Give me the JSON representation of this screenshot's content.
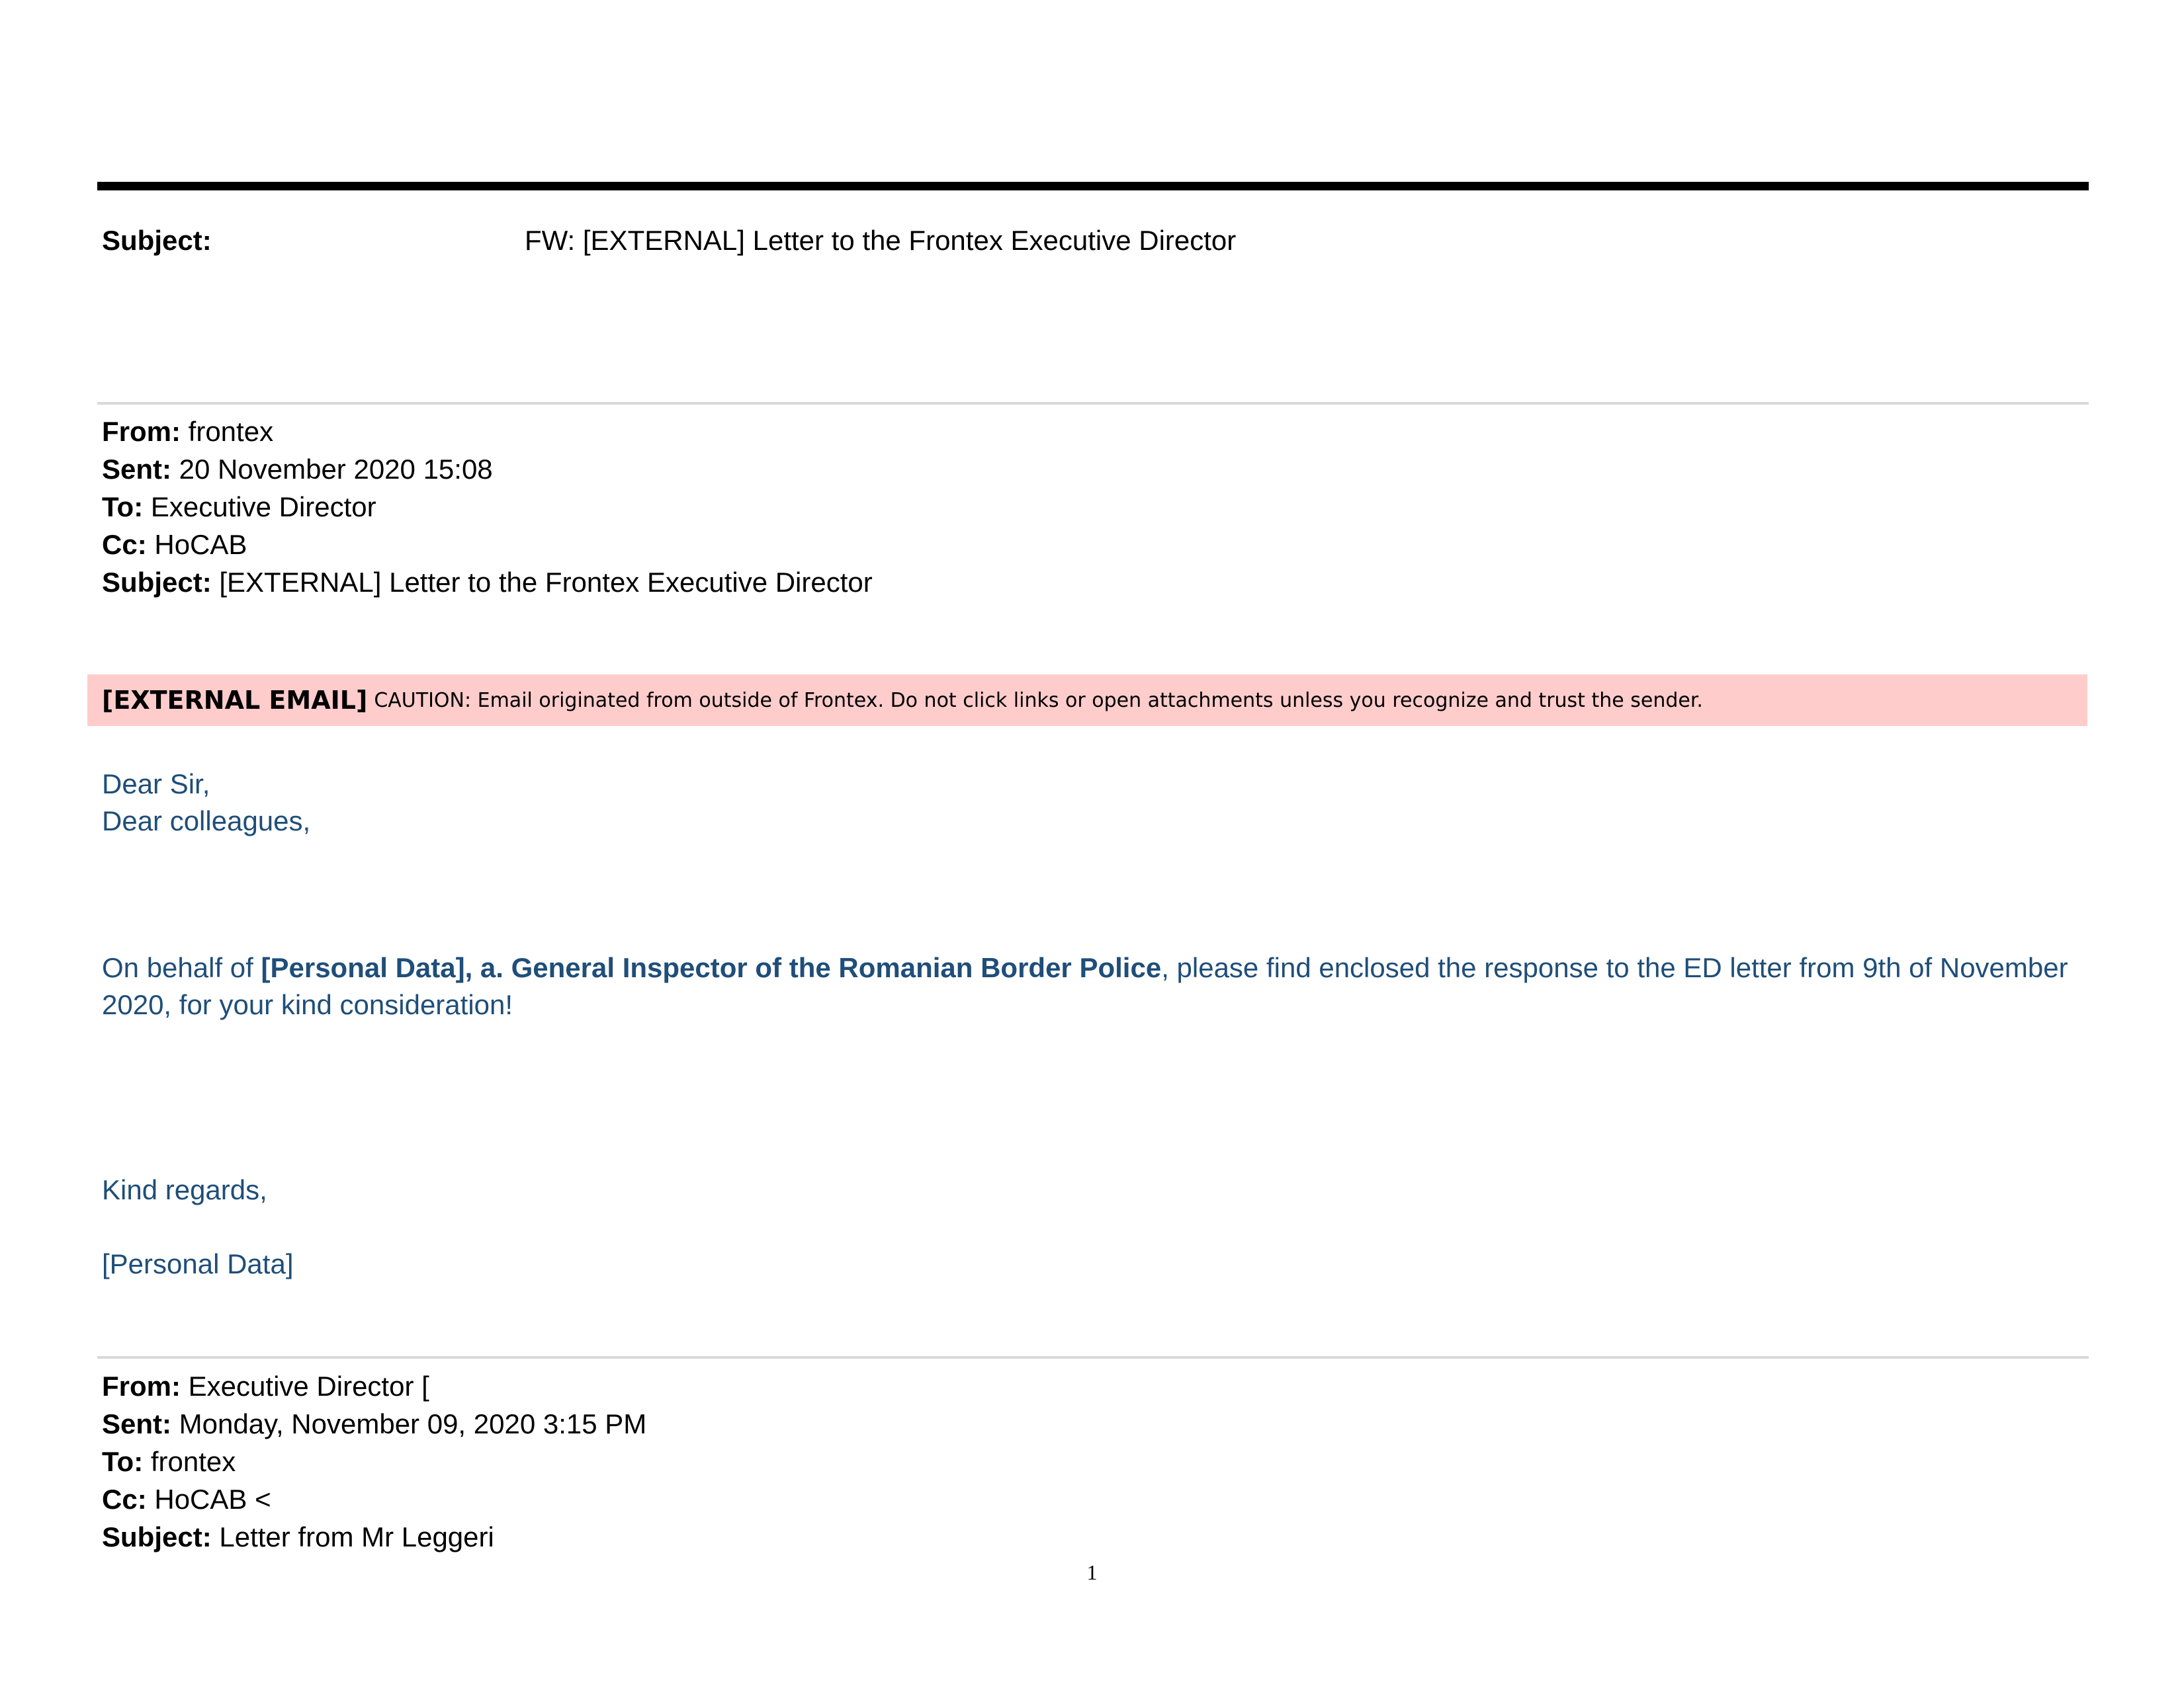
{
  "top_subject": {
    "label": "Subject:",
    "value": "FW: [EXTERNAL] Letter to the Frontex Executive Director"
  },
  "header_1": {
    "from_label": "From:",
    "from_value": " frontex",
    "sent_label": "Sent:",
    "sent_value": " 20 November 2020 15:08",
    "to_label": "To:",
    "to_value": " Executive Director",
    "cc_label": "Cc:",
    "cc_value": " HoCAB",
    "subject_label": "Subject:",
    "subject_value": " [EXTERNAL] Letter to the Frontex Executive Director"
  },
  "banner": {
    "tag": "[EXTERNAL EMAIL]",
    "text": "CAUTION: Email originated from outside of Frontex. Do not click links or open attachments unless you recognize and trust the sender.",
    "color": "#ffcccc"
  },
  "body": {
    "greeting_1": "Dear Sir,",
    "greeting_2": "Dear colleagues,",
    "para_pre": "On behalf of ",
    "para_bold": "[Personal Data], a. General Inspector of the Romanian Border Police",
    "para_post": ", please find enclosed the response to the ED letter from 9th of November 2020, for your kind consideration!",
    "closing": "Kind regards,",
    "signature": "[Personal Data]",
    "color": "#1f4e79"
  },
  "header_2": {
    "from_label": "From:",
    "from_value": " Executive Director [",
    "sent_label": "Sent:",
    "sent_value": " Monday, November 09, 2020 3:15 PM",
    "to_label": "To:",
    "to_value": " frontex",
    "cc_label": "Cc:",
    "cc_value": " HoCAB <",
    "subject_label": "Subject:",
    "subject_value": " Letter from Mr Leggeri"
  },
  "page_number": "1"
}
